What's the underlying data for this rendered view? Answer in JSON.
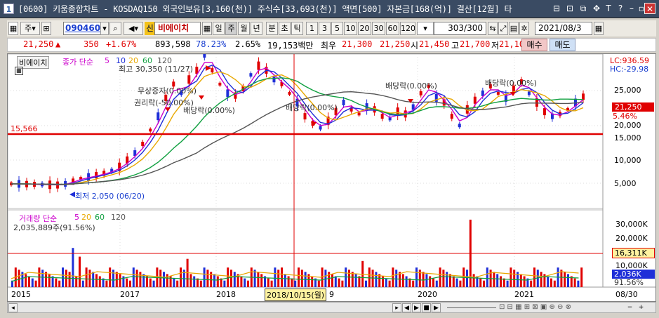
{
  "window": {
    "number": "1",
    "title": "[0600] 키움종합차트 - KOSDAQ150 외국인보유[3,160(천)] 주식수[33,693(천)] 액면[500] 자본금[168(억)] 결산[12월] 타",
    "title_buttons": [
      "⊟",
      "⊡",
      "⧉",
      "✥",
      "T",
      "?",
      "–",
      "▫",
      "✕"
    ]
  },
  "toolbar": {
    "stock_type": "주",
    "type_arrow": "▾",
    "grid_btn": "⊞",
    "code": "090460",
    "search_btn": "🔍",
    "sound_btn": "🔊",
    "shin": "신",
    "name": "비에이치",
    "period_btns": [
      "일",
      "주",
      "월",
      "년",
      "분",
      "초",
      "틱"
    ],
    "selected_period": "주",
    "intervals": [
      "1",
      "3",
      "5",
      "10",
      "20",
      "30",
      "60",
      "120"
    ],
    "count": "303/300",
    "date": "2021/08/3",
    "tool_icons": [
      "⇆",
      "⤢",
      "▤",
      "✲",
      "▦"
    ]
  },
  "quote": {
    "price": "21,250",
    "arrow": "▲",
    "change": "350",
    "change_pct": "+1.67%",
    "volume": "893,598",
    "ratio": "78.23%",
    "turnover": "2.65%",
    "amount": "19,153백만",
    "best_label": "최우",
    "bid1": "21,300",
    "bid2": "21,250",
    "open_label": "시",
    "open": "21,450",
    "high_label": "고",
    "high": "21,700",
    "low_label": "저",
    "low": "21,100",
    "buy": "매수",
    "sell": "매도"
  },
  "price_panel": {
    "stock_name": "비에이치",
    "ma_legend": "종가 단순",
    "ma_periods": [
      "5",
      "10",
      "20",
      "60",
      "120"
    ],
    "ma_colors": [
      "#cc00cc",
      "#1f2fd8",
      "#e8a800",
      "#10a040",
      "#555555"
    ],
    "lc": "LC:936.59",
    "hc": "HC:-29.98",
    "y_labels": [
      "25,000",
      "20,000",
      "15,000",
      "10,000",
      "5,000"
    ],
    "current_price": "21,250",
    "current_pct": "5.46%",
    "ref_line": "15,566",
    "annotations": {
      "high": "최고 30,350 (11/27)",
      "low": "최저 2,050 (06/20)",
      "rights1": "무상증자(0.00%)",
      "rights2": "권리락(-50.00%)",
      "div1": "배당락(0.00%)",
      "div2": "배당락(0.00%)",
      "div3": "배당락(0.00%)",
      "div4": "배당락(0.00%)"
    }
  },
  "volume_panel": {
    "legend": "거래량 단순",
    "ma_periods": [
      "5",
      "20",
      "60",
      "120"
    ],
    "ma_colors": [
      "#cc00cc",
      "#e8a800",
      "#10a040",
      "#555555"
    ],
    "value_text": "2,035,889주(91.56%)",
    "y_labels": [
      "30,000K",
      "20,000K",
      "10,000K"
    ],
    "ref_value": "16,311K",
    "current_value": "2,036K",
    "current_pct": "91.56%"
  },
  "x_axis": {
    "labels": [
      "2015",
      "2017",
      "2018",
      "2020",
      "2021"
    ],
    "tail_label": "08/30",
    "cursor_date": "2018/10/15(월)",
    "cursor_tail": "9"
  },
  "scroll": {
    "left": "◂",
    "right": "▸",
    "play_btns": [
      "◀",
      "▶",
      "■",
      "▶"
    ],
    "zoom": [
      "−",
      "+"
    ]
  }
}
